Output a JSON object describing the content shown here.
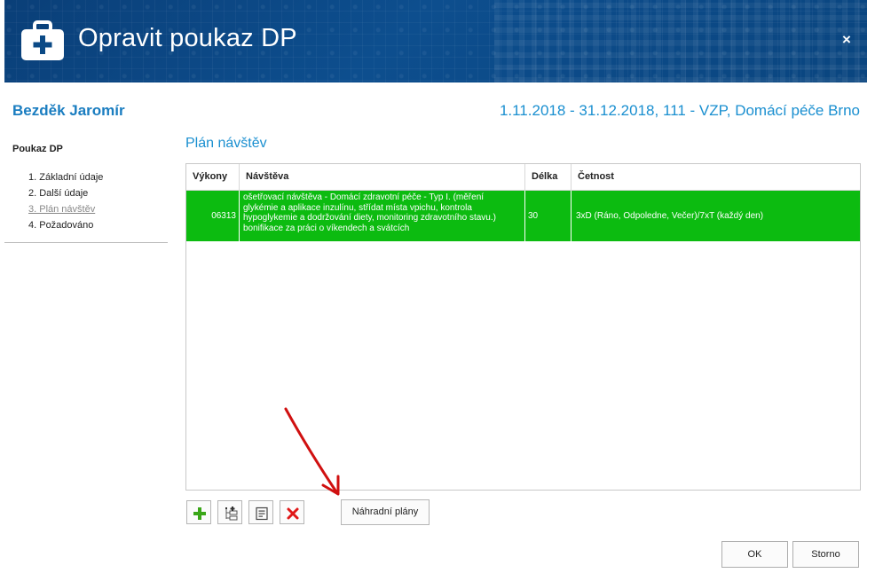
{
  "dialog": {
    "title": "Opravit poukaz DP",
    "close_label": "×"
  },
  "patient": {
    "name": "Bezděk Jaromír",
    "period": "1.11.2018 - 31.12.2018, 111 - VZP, Domácí péče Brno"
  },
  "sidebar": {
    "title": "Poukaz DP",
    "items": [
      {
        "label": "1. Základní údaje"
      },
      {
        "label": "2. Další údaje"
      },
      {
        "label": "3. Plán návštěv"
      },
      {
        "label": "4. Požadováno"
      }
    ]
  },
  "section": {
    "title": "Plán návštěv"
  },
  "grid": {
    "columns": [
      "Výkony",
      "Návštěva",
      "Délka",
      "Četnost"
    ],
    "rows": [
      {
        "code": "06313",
        "visit": "ošetřovací návštěva - Domácí zdravotní péče - Typ I. (měření glykémie a aplikace inzulínu, střídat místa vpichu, kontrola hypoglykemie a dodržování diety, monitoring zdravotního stavu.) bonifikace za práci o víkendech a svátcích",
        "length": "30",
        "frequency": "3xD (Ráno, Odpoledne, Večer)/7xT (každý den)"
      }
    ],
    "selected_row_color": "#0cbb10"
  },
  "toolbar": {
    "add_icon": "plus-icon",
    "add_tree_icon": "add-tree-icon",
    "edit_icon": "edit-note-icon",
    "delete_icon": "delete-x-icon",
    "alt_plans_label": "Náhradní plány"
  },
  "footer": {
    "ok_label": "OK",
    "cancel_label": "Storno"
  },
  "colors": {
    "title_bar": "#0b4a86",
    "accent_text": "#1a8fd0",
    "annotation_arrow": "#d01010"
  }
}
